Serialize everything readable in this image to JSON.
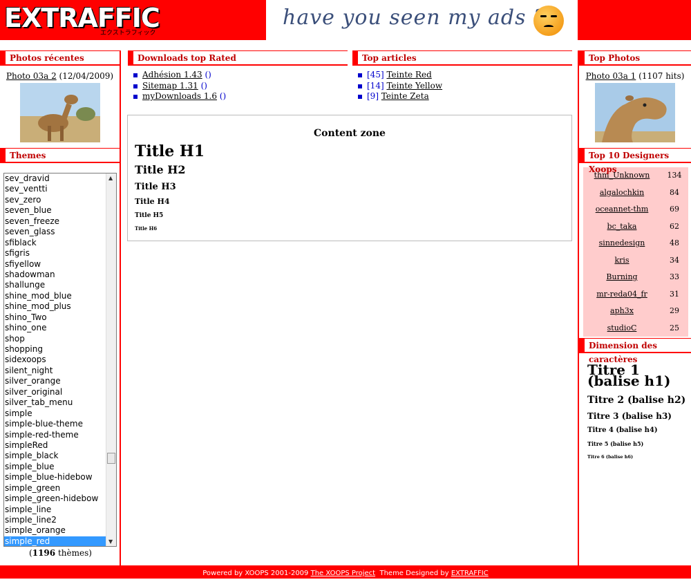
{
  "header": {
    "logo_text": "EXTRAFFIC",
    "logo_kana": "エクストラフィック",
    "banner_slogan": "have you seen my ads ?"
  },
  "left": {
    "recent_photos": {
      "title": "Photos récentes",
      "photo_link": "Photo 03a 2",
      "photo_date": "(12/04/2009)"
    },
    "themes": {
      "title": "Themes",
      "items": [
        "sev_dravid",
        "sev_ventti",
        "sev_zero",
        "seven_blue",
        "seven_freeze",
        "seven_glass",
        "sfiblack",
        "sfigris",
        "sfiyellow",
        "shadowman",
        "shallunge",
        "shine_mod_blue",
        "shine_mod_plus",
        "shino_Two",
        "shino_one",
        "shop",
        "shopping",
        "sidexoops",
        "silent_night",
        "silver_orange",
        "silver_original",
        "silver_tab_menu",
        "simple",
        "simple-blue-theme",
        "simple-red-theme",
        "simpleRed",
        "simple_black",
        "simple_blue",
        "simple_blue-hidebow",
        "simple_green",
        "simple_green-hidebow",
        "simple_line",
        "simple_line2",
        "simple_orange",
        "simple_red"
      ],
      "selected": "simple_red",
      "count": "1196",
      "count_label": "thèmes"
    }
  },
  "center": {
    "downloads": {
      "title": "Downloads top Rated",
      "items": [
        {
          "label": "Adhésion 1.43",
          "extra": "()"
        },
        {
          "label": "Sitemap 1.31",
          "extra": "()"
        },
        {
          "label": "myDownloads 1.6",
          "extra": "()"
        }
      ]
    },
    "articles": {
      "title": "Top articles",
      "items": [
        {
          "count": "[45]",
          "label": "Teinte Red"
        },
        {
          "count": "[14]",
          "label": "Teinte Yellow"
        },
        {
          "count": "[9]",
          "label": "Teinte Zeta"
        }
      ]
    },
    "content_zone": {
      "title": "Content zone",
      "h1": "Title H1",
      "h2": "Title H2",
      "h3": "Title H3",
      "h4": "Title H4",
      "h5": "Title H5",
      "h6": "Title H6"
    }
  },
  "right": {
    "top_photos": {
      "title": "Top Photos",
      "photo_link": "Photo 03a 1",
      "hits": "(1107 hits)"
    },
    "designers": {
      "title": "Top 10 Designers Xoops",
      "rows": [
        {
          "name": "thm_Unknown",
          "count": "134"
        },
        {
          "name": "algalochkin",
          "count": "84"
        },
        {
          "name": "oceannet-thm",
          "count": "69"
        },
        {
          "name": "bc_taka",
          "count": "62"
        },
        {
          "name": "sinnedesign",
          "count": "48"
        },
        {
          "name": "kris",
          "count": "34"
        },
        {
          "name": "Burning",
          "count": "33"
        },
        {
          "name": "mr-reda04_fr",
          "count": "31"
        },
        {
          "name": "aph3x",
          "count": "29"
        },
        {
          "name": "studioC",
          "count": "25"
        }
      ]
    },
    "dimension": {
      "title": "Dimension des caractères",
      "h1": "Titre 1 (balise h1)",
      "h2": "Titre 2 (balise h2)",
      "h3": "Titre 3 (balise h3)",
      "h4": "Titre 4 (balise h4)",
      "h5": "Titre 5 (balise h5)",
      "h6": "Titre 6 (balise h6)"
    }
  },
  "footer": {
    "powered": "Powered by XOOPS 2001-2009",
    "project": "The XOOPS Project",
    "designed": "Theme Designed by",
    "designer": "EXTRAFFIC"
  },
  "colors": {
    "accent_red": "#ff0000",
    "title_red": "#c00000",
    "bullet_blue": "#0000cc",
    "designers_bg": "#ffcccc",
    "selection_blue": "#3399ff"
  },
  "icons": [
    "smiley-icon",
    "bullet-icon",
    "scroll-up-icon",
    "scroll-down-icon"
  ]
}
